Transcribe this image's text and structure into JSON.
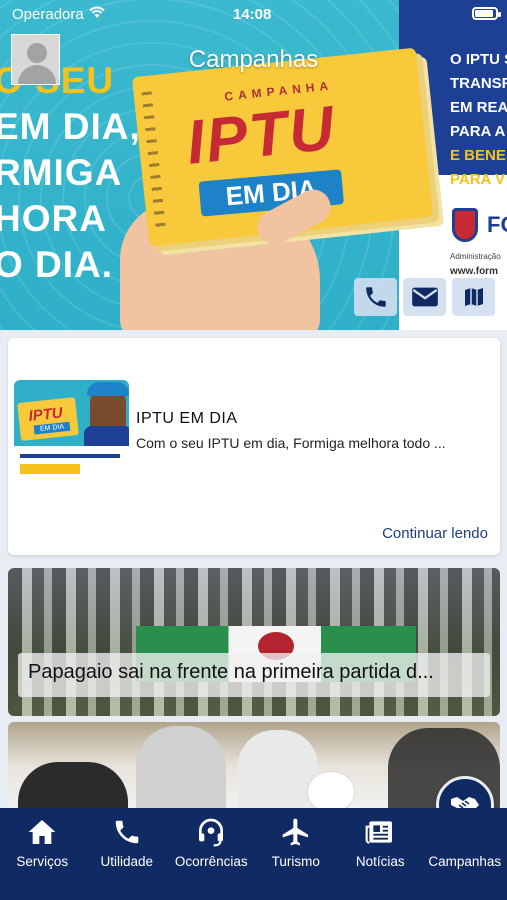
{
  "status_bar": {
    "carrier": "Operadora",
    "time": "14:08"
  },
  "header": {
    "title": "Campanhas"
  },
  "hero": {
    "slogan_lines": [
      "O SEU",
      "EM DIA,",
      "RMIGA",
      "HORA",
      "O DIA."
    ],
    "booklet_small": "CAMPANHA",
    "booklet_big": "IPTU",
    "booklet_band": "EM DIA",
    "promo_lines": [
      "O IPTU S",
      "TRANSF",
      "EM REA",
      "PARA A",
      "E BENE",
      "PARA V"
    ],
    "crest_name": "FO",
    "crest_sub": "Administração",
    "crest_url": "www.form"
  },
  "actions": {
    "phone": "phone-icon",
    "mail": "mail-icon",
    "map": "map-icon"
  },
  "news_card": {
    "title": "IPTU EM DIA",
    "excerpt": "Com o seu IPTU em dia, Formiga melhora todo ...",
    "continue_label": "Continuar lendo",
    "thumb_text": "IPTU",
    "thumb_band": "EM DIA"
  },
  "photo_card_1": {
    "caption": "Papagaio sai na frente na primeira partida d..."
  },
  "tabs": [
    {
      "label": "Serviços",
      "icon": "home-icon"
    },
    {
      "label": "Utilidade",
      "icon": "phone-icon"
    },
    {
      "label": "Ocorrências",
      "icon": "headset-icon"
    },
    {
      "label": "Turismo",
      "icon": "airplane-icon"
    },
    {
      "label": "Notícias",
      "icon": "newspaper-icon"
    },
    {
      "label": "Campanhas",
      "icon": "handshake-icon"
    }
  ],
  "colors": {
    "nav_bg": "#102a64",
    "hero_bg": "#2fb0c8",
    "accent_yellow": "#f5c21b",
    "brand_red": "#c62a34"
  }
}
